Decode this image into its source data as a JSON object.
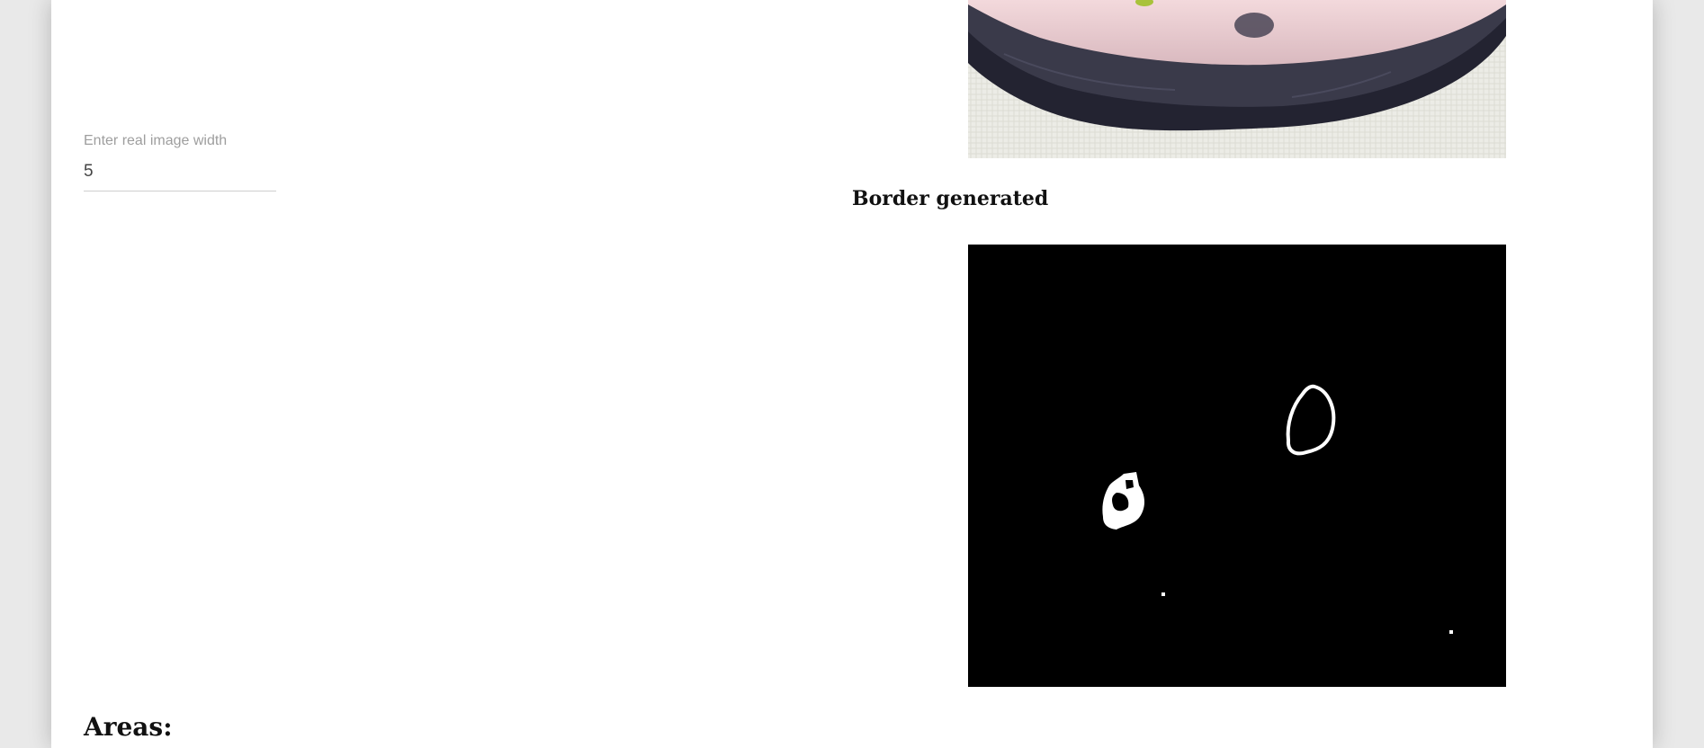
{
  "form": {
    "width_label": "Enter real image width",
    "width_value": "5"
  },
  "sections": {
    "border_title": "Border generated",
    "areas_title": "Areas:"
  },
  "colors": {
    "page_bg": "#ffffff",
    "outer_bg": "#e9e9e9",
    "mask_bg": "#000000",
    "mask_fg": "#ffffff"
  }
}
